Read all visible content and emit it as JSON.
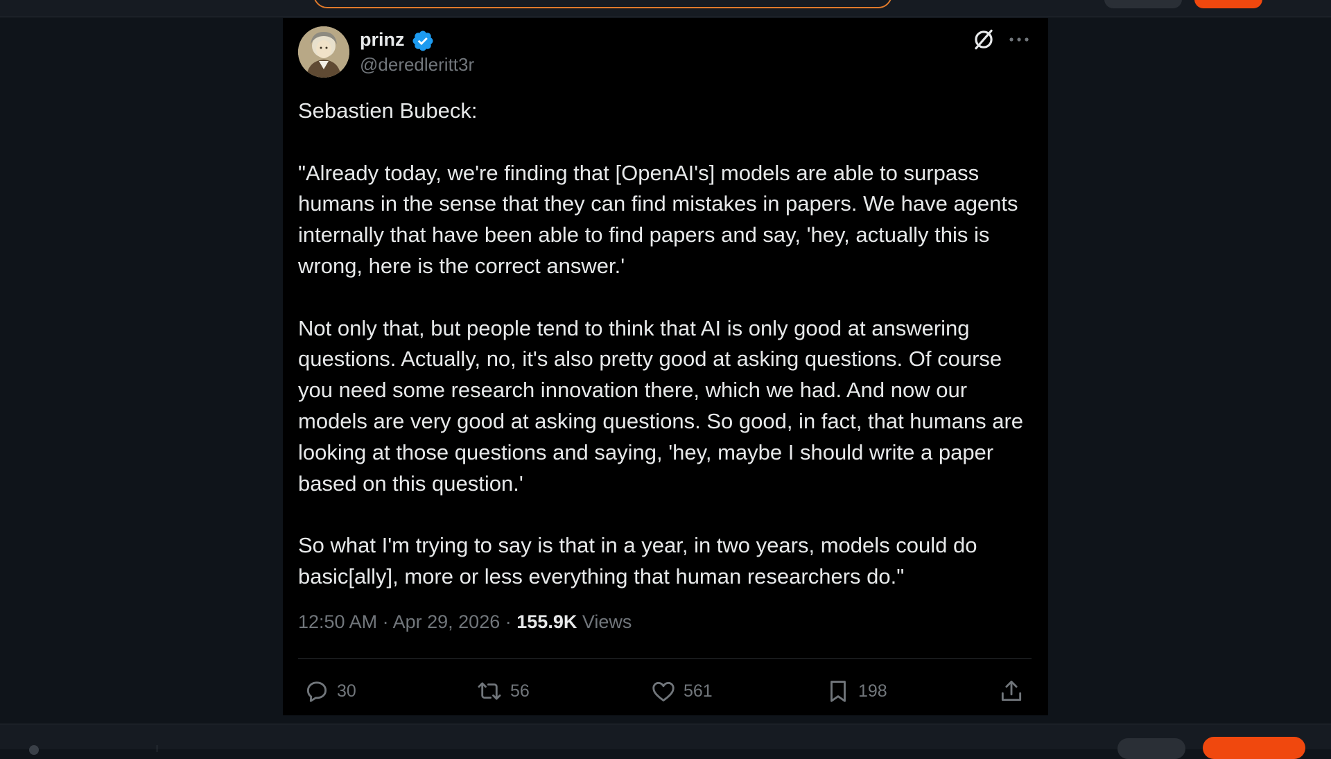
{
  "tweet": {
    "author": {
      "display_name": "prinz",
      "handle": "@deredleritt3r",
      "verified": true
    },
    "paragraphs": [
      "Sebastien Bubeck:",
      "\"Already today, we're finding that [OpenAI's] models are able to surpass humans in the sense that they can find mistakes in papers. We have agents internally that have been able to find papers and say, 'hey, actually this is wrong, here is the correct answer.'",
      "Not only that, but people tend to think that AI is only good at answering questions. Actually, no, it's also pretty good at asking questions. Of course you need some research innovation there, which we had. And now our models are very good at asking questions. So good, in fact, that humans are looking at those questions and saying, 'hey, maybe I should write a paper based on this question.'",
      "So what I'm trying to say is that in a year, in two years, models could do basic[ally], more or less everything that human researchers do.\""
    ],
    "time": "12:50 AM",
    "date": "Apr 29, 2026",
    "separator": "·",
    "views_count": "155.9K",
    "views_label": "Views",
    "stats": {
      "replies": "30",
      "reposts": "56",
      "likes": "561",
      "bookmarks": "198"
    }
  },
  "colors": {
    "page_background": "#0f141a",
    "tweet_background": "#000000",
    "text_primary": "#e7e9ea",
    "text_secondary": "#71767b",
    "verified_blue": "#1d9bf0",
    "accent_orange": "#f0480e"
  },
  "icons": {
    "verified": "verified-badge-icon",
    "grok": "grok-icon",
    "more": "more-dots-icon",
    "reply": "reply-bubble-icon",
    "repost": "repost-arrows-icon",
    "like": "heart-icon",
    "bookmark": "bookmark-icon",
    "share": "share-upload-icon"
  }
}
